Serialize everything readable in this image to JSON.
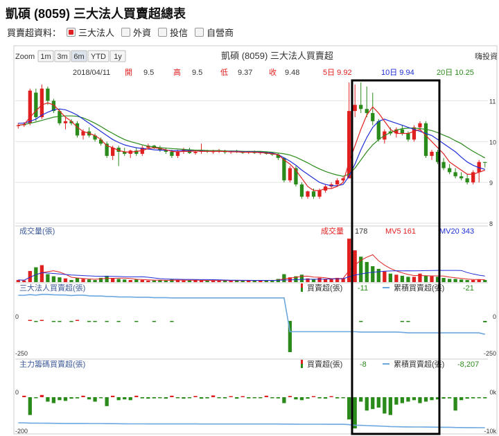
{
  "page_title": "凱碩 (8059) 三大法人買賣超總表",
  "filter": {
    "label": "買賣超資料：",
    "options": [
      {
        "label": "三大法人",
        "checked": true
      },
      {
        "label": "外資",
        "checked": false
      },
      {
        "label": "投信",
        "checked": false
      },
      {
        "label": "自營商",
        "checked": false
      }
    ]
  },
  "zoom": {
    "label": "Zoom",
    "buttons": [
      "1m",
      "3m",
      "6m",
      "YTD",
      "1y"
    ],
    "active": "6m"
  },
  "chart_title": "凱碩 (8059) 三大法人買賣超",
  "corner_label": "嗨投資",
  "info": {
    "date": "2018/04/11",
    "open_label": "開",
    "open": "9.5",
    "high_label": "高",
    "high": "9.5",
    "low_label": "低",
    "low": "9.37",
    "close_label": "收",
    "close": "9.48",
    "ma5": "5日 9.92",
    "ma10": "10日 9.94",
    "ma20": "20日 10.25"
  },
  "volume_panel": {
    "title": "成交量(張)",
    "vol_label": "成交量",
    "vol_value": "178",
    "mv5": "MV5 161",
    "mv20": "MV20 343"
  },
  "inst_panel": {
    "title": "三大法人買賣超(張)",
    "net_label": "買賣超(張)",
    "net_value": "-11",
    "cum_label": "累積買賣超(張)",
    "cum_value": "-21",
    "yticks": [
      "0",
      "-250"
    ],
    "right_ticks": [
      "0",
      "-250"
    ]
  },
  "main_panel": {
    "title": "主力籌碼買賣超(張)",
    "net_label": "買賣超(張)",
    "net_value": "-8",
    "cum_label": "累積買賣超(張)",
    "cum_value": "-8,207",
    "yticks": [
      "0",
      "-200"
    ],
    "right_ticks": [
      "0k",
      "-10k"
    ]
  },
  "price_ticks": [
    "11",
    "10",
    "9",
    "8"
  ],
  "colors": {
    "up": "#e02020",
    "down": "#2a8a1a",
    "ma5": "#e02020",
    "ma10": "#1e2fd6",
    "ma20": "#2a8a1a",
    "cumulative": "#6aa7df",
    "highlight": "#000000"
  },
  "chart_data": {
    "type": "candlestick",
    "y_range": [
      8,
      11.5
    ],
    "candles": [
      {
        "o": 10.38,
        "h": 10.45,
        "l": 10.32,
        "c": 10.4
      },
      {
        "o": 10.4,
        "h": 10.48,
        "l": 10.36,
        "c": 10.42
      },
      {
        "o": 10.45,
        "h": 11.3,
        "l": 10.4,
        "c": 11.25
      },
      {
        "o": 11.2,
        "h": 11.3,
        "l": 10.5,
        "c": 10.6
      },
      {
        "o": 10.6,
        "h": 11.4,
        "l": 10.55,
        "c": 11.3
      },
      {
        "o": 11.3,
        "h": 11.35,
        "l": 10.9,
        "c": 11.0
      },
      {
        "o": 11.0,
        "h": 11.05,
        "l": 10.7,
        "c": 10.75
      },
      {
        "o": 10.75,
        "h": 10.8,
        "l": 10.4,
        "c": 10.45
      },
      {
        "o": 10.45,
        "h": 10.6,
        "l": 10.3,
        "c": 10.5
      },
      {
        "o": 10.5,
        "h": 10.55,
        "l": 10.4,
        "c": 10.45
      },
      {
        "o": 10.45,
        "h": 10.5,
        "l": 10.1,
        "c": 10.15
      },
      {
        "o": 10.15,
        "h": 10.3,
        "l": 10.05,
        "c": 10.25
      },
      {
        "o": 10.25,
        "h": 10.35,
        "l": 10.1,
        "c": 10.15
      },
      {
        "o": 10.15,
        "h": 10.2,
        "l": 10.0,
        "c": 10.05
      },
      {
        "o": 10.05,
        "h": 10.1,
        "l": 9.9,
        "c": 9.95
      },
      {
        "o": 9.95,
        "h": 10.0,
        "l": 9.6,
        "c": 9.65
      },
      {
        "o": 9.65,
        "h": 9.9,
        "l": 9.55,
        "c": 9.85
      },
      {
        "o": 9.85,
        "h": 9.9,
        "l": 9.4,
        "c": 9.75
      },
      {
        "o": 9.75,
        "h": 9.85,
        "l": 9.65,
        "c": 9.7
      },
      {
        "o": 9.7,
        "h": 9.8,
        "l": 9.6,
        "c": 9.78
      },
      {
        "o": 9.78,
        "h": 9.85,
        "l": 9.65,
        "c": 9.7
      },
      {
        "o": 9.7,
        "h": 9.9,
        "l": 9.65,
        "c": 9.85
      },
      {
        "o": 9.85,
        "h": 9.95,
        "l": 9.8,
        "c": 9.9
      },
      {
        "o": 9.9,
        "h": 9.92,
        "l": 9.82,
        "c": 9.85
      },
      {
        "o": 9.85,
        "h": 9.9,
        "l": 9.75,
        "c": 9.8
      },
      {
        "o": 9.8,
        "h": 9.85,
        "l": 9.7,
        "c": 9.75
      },
      {
        "o": 9.75,
        "h": 9.8,
        "l": 9.6,
        "c": 9.65
      },
      {
        "o": 9.65,
        "h": 9.8,
        "l": 9.6,
        "c": 9.75
      },
      {
        "o": 9.75,
        "h": 9.85,
        "l": 9.7,
        "c": 9.8
      },
      {
        "o": 9.8,
        "h": 9.85,
        "l": 9.7,
        "c": 9.72
      },
      {
        "o": 9.72,
        "h": 9.78,
        "l": 9.68,
        "c": 9.75
      },
      {
        "o": 9.75,
        "h": 9.95,
        "l": 9.7,
        "c": 9.78
      },
      {
        "o": 9.78,
        "h": 9.8,
        "l": 9.72,
        "c": 9.75
      },
      {
        "o": 9.75,
        "h": 9.8,
        "l": 9.7,
        "c": 9.76
      },
      {
        "o": 9.76,
        "h": 9.82,
        "l": 9.72,
        "c": 9.78
      },
      {
        "o": 9.78,
        "h": 9.8,
        "l": 9.7,
        "c": 9.74
      },
      {
        "o": 9.74,
        "h": 9.78,
        "l": 9.7,
        "c": 9.76
      },
      {
        "o": 9.76,
        "h": 9.8,
        "l": 9.72,
        "c": 9.74
      },
      {
        "o": 9.74,
        "h": 9.77,
        "l": 9.7,
        "c": 9.73
      },
      {
        "o": 9.73,
        "h": 9.77,
        "l": 9.7,
        "c": 9.75
      },
      {
        "o": 9.75,
        "h": 9.78,
        "l": 9.7,
        "c": 9.72
      },
      {
        "o": 9.72,
        "h": 9.76,
        "l": 9.68,
        "c": 9.74
      },
      {
        "o": 9.74,
        "h": 9.76,
        "l": 9.68,
        "c": 9.7
      },
      {
        "o": 9.7,
        "h": 9.75,
        "l": 9.65,
        "c": 9.68
      },
      {
        "o": 9.68,
        "h": 9.72,
        "l": 9.55,
        "c": 9.6
      },
      {
        "o": 9.6,
        "h": 9.62,
        "l": 9.0,
        "c": 9.05
      },
      {
        "o": 9.05,
        "h": 9.4,
        "l": 9.0,
        "c": 9.35
      },
      {
        "o": 9.35,
        "h": 9.4,
        "l": 8.9,
        "c": 8.95
      },
      {
        "o": 8.95,
        "h": 9.0,
        "l": 8.6,
        "c": 8.65
      },
      {
        "o": 8.65,
        "h": 8.8,
        "l": 8.6,
        "c": 8.78
      },
      {
        "o": 8.78,
        "h": 8.85,
        "l": 8.6,
        "c": 8.65
      },
      {
        "o": 8.65,
        "h": 8.85,
        "l": 8.6,
        "c": 8.8
      },
      {
        "o": 8.8,
        "h": 8.95,
        "l": 8.75,
        "c": 8.9
      },
      {
        "o": 8.9,
        "h": 9.0,
        "l": 8.85,
        "c": 8.95
      },
      {
        "o": 8.95,
        "h": 9.1,
        "l": 8.9,
        "c": 9.05
      },
      {
        "o": 9.05,
        "h": 9.15,
        "l": 9.0,
        "c": 9.1
      },
      {
        "o": 9.1,
        "h": 11.45,
        "l": 9.1,
        "c": 10.75
      },
      {
        "o": 10.75,
        "h": 11.4,
        "l": 10.6,
        "c": 10.9
      },
      {
        "o": 10.9,
        "h": 11.45,
        "l": 10.7,
        "c": 10.8
      },
      {
        "o": 10.8,
        "h": 11.35,
        "l": 10.6,
        "c": 10.7
      },
      {
        "o": 10.7,
        "h": 11.2,
        "l": 10.4,
        "c": 10.5
      },
      {
        "o": 10.5,
        "h": 10.55,
        "l": 10.0,
        "c": 10.05
      },
      {
        "o": 10.05,
        "h": 10.3,
        "l": 9.95,
        "c": 10.25
      },
      {
        "o": 10.25,
        "h": 10.35,
        "l": 10.15,
        "c": 10.2
      },
      {
        "o": 10.2,
        "h": 10.35,
        "l": 10.1,
        "c": 10.3
      },
      {
        "o": 10.3,
        "h": 10.4,
        "l": 10.15,
        "c": 10.2
      },
      {
        "o": 10.2,
        "h": 10.25,
        "l": 10.0,
        "c": 10.05
      },
      {
        "o": 10.05,
        "h": 10.4,
        "l": 10.0,
        "c": 10.35
      },
      {
        "o": 10.35,
        "h": 10.5,
        "l": 10.25,
        "c": 10.45
      },
      {
        "o": 10.45,
        "h": 10.5,
        "l": 9.6,
        "c": 9.65
      },
      {
        "o": 9.65,
        "h": 9.8,
        "l": 9.55,
        "c": 9.75
      },
      {
        "o": 9.75,
        "h": 9.8,
        "l": 9.45,
        "c": 9.5
      },
      {
        "o": 9.5,
        "h": 9.6,
        "l": 9.3,
        "c": 9.35
      },
      {
        "o": 9.35,
        "h": 9.45,
        "l": 9.2,
        "c": 9.25
      },
      {
        "o": 9.25,
        "h": 9.35,
        "l": 9.1,
        "c": 9.15
      },
      {
        "o": 9.15,
        "h": 9.25,
        "l": 9.05,
        "c": 9.1
      },
      {
        "o": 9.1,
        "h": 9.2,
        "l": 8.95,
        "c": 9.0
      },
      {
        "o": 9.0,
        "h": 9.3,
        "l": 8.95,
        "c": 9.25
      },
      {
        "o": 9.25,
        "h": 9.55,
        "l": 9.0,
        "c": 9.5
      },
      {
        "o": 9.5,
        "h": 9.5,
        "l": 9.37,
        "c": 9.48
      }
    ],
    "ma5": [
      10.4,
      10.42,
      10.6,
      10.75,
      10.9,
      10.95,
      10.9,
      10.75,
      10.6,
      10.5,
      10.35,
      10.25,
      10.2,
      10.15,
      10.05,
      9.9,
      9.85,
      9.78,
      9.75,
      9.74,
      9.76,
      9.78,
      9.83,
      9.85,
      9.83,
      9.8,
      9.76,
      9.75,
      9.76,
      9.76,
      9.77,
      9.76,
      9.76,
      9.76,
      9.76,
      9.76,
      9.75,
      9.75,
      9.74,
      9.74,
      9.74,
      9.73,
      9.72,
      9.7,
      9.68,
      9.55,
      9.45,
      9.3,
      9.1,
      8.9,
      8.8,
      8.8,
      8.85,
      8.85,
      8.9,
      9.0,
      9.5,
      9.9,
      10.3,
      10.65,
      10.85,
      10.7,
      10.5,
      10.3,
      10.2,
      10.2,
      10.2,
      10.25,
      10.3,
      10.15,
      10.0,
      9.85,
      9.7,
      9.5,
      9.4,
      9.3,
      9.2,
      9.2,
      9.25,
      9.3
    ],
    "ma10": [
      10.45,
      10.45,
      10.5,
      10.55,
      10.65,
      10.72,
      10.78,
      10.8,
      10.78,
      10.72,
      10.65,
      10.55,
      10.45,
      10.35,
      10.25,
      10.15,
      10.05,
      9.98,
      9.92,
      9.88,
      9.85,
      9.83,
      9.82,
      9.8,
      9.79,
      9.79,
      9.78,
      9.78,
      9.78,
      9.78,
      9.77,
      9.77,
      9.76,
      9.76,
      9.76,
      9.76,
      9.76,
      9.76,
      9.75,
      9.75,
      9.75,
      9.74,
      9.73,
      9.72,
      9.68,
      9.6,
      9.52,
      9.42,
      9.3,
      9.2,
      9.1,
      9.0,
      8.95,
      8.92,
      8.92,
      8.95,
      9.15,
      9.45,
      9.8,
      10.1,
      10.35,
      10.5,
      10.55,
      10.5,
      10.45,
      10.4,
      10.35,
      10.3,
      10.25,
      10.2,
      10.15,
      10.05,
      9.95,
      9.85,
      9.75,
      9.62,
      9.5,
      9.42,
      9.36,
      9.32
    ],
    "ma20": [
      10.4,
      10.42,
      10.45,
      10.48,
      10.52,
      10.56,
      10.6,
      10.62,
      10.63,
      10.63,
      10.62,
      10.58,
      10.52,
      10.45,
      10.37,
      10.28,
      10.2,
      10.12,
      10.05,
      10.0,
      9.96,
      9.92,
      9.89,
      9.87,
      9.85,
      9.84,
      9.83,
      9.82,
      9.81,
      9.8,
      9.79,
      9.79,
      9.78,
      9.78,
      9.78,
      9.77,
      9.77,
      9.77,
      9.76,
      9.76,
      9.76,
      9.76,
      9.75,
      9.74,
      9.72,
      9.7,
      9.67,
      9.62,
      9.55,
      9.48,
      9.4,
      9.33,
      9.27,
      9.22,
      9.18,
      9.15,
      9.2,
      9.35,
      9.55,
      9.75,
      9.92,
      10.05,
      10.15,
      10.22,
      10.28,
      10.32,
      10.33,
      10.33,
      10.32,
      10.3,
      10.27,
      10.22,
      10.16,
      10.1,
      10.02,
      9.95,
      9.85,
      9.76,
      9.68,
      9.6
    ],
    "volume": [
      40,
      30,
      210,
      280,
      320,
      150,
      110,
      90,
      70,
      40,
      80,
      60,
      50,
      40,
      80,
      120,
      70,
      60,
      50,
      40,
      50,
      40,
      30,
      30,
      40,
      30,
      50,
      40,
      30,
      30,
      40,
      30,
      30,
      30,
      30,
      30,
      30,
      30,
      30,
      30,
      30,
      30,
      30,
      40,
      60,
      150,
      90,
      110,
      140,
      70,
      60,
      80,
      60,
      60,
      80,
      70,
      820,
      600,
      480,
      380,
      300,
      250,
      200,
      160,
      140,
      120,
      100,
      100,
      160,
      120,
      110,
      100,
      80,
      60,
      60,
      50,
      40,
      40,
      50,
      40
    ],
    "inst_net": [
      0,
      0,
      5,
      -4,
      6,
      0,
      -3,
      -2,
      0,
      -4,
      3,
      0,
      -5,
      -2,
      0,
      -3,
      0,
      -4,
      0,
      0,
      -2,
      0,
      0,
      -3,
      0,
      0,
      -2,
      0,
      0,
      0,
      0,
      0,
      0,
      0,
      0,
      0,
      0,
      0,
      0,
      0,
      0,
      0,
      0,
      0,
      0,
      0,
      -260,
      0,
      0,
      0,
      0,
      0,
      0,
      0,
      0,
      0,
      0,
      0,
      -3,
      0,
      0,
      0,
      0,
      0,
      0,
      -2,
      -4,
      0,
      0,
      0,
      0,
      0,
      0,
      0,
      0,
      0,
      0,
      0,
      0,
      -11
    ],
    "inst_cum": [
      0,
      0,
      5,
      1,
      7,
      7,
      4,
      2,
      2,
      -2,
      1,
      1,
      -4,
      -6,
      -6,
      -9,
      -9,
      -13,
      -13,
      -13,
      -15,
      -15,
      -15,
      -18,
      -18,
      -18,
      -20,
      -20,
      -20,
      -20,
      -20,
      -20,
      -20,
      -20,
      -20,
      -20,
      -20,
      -20,
      -20,
      -20,
      -20,
      -20,
      -20,
      -20,
      -20,
      -20,
      -280,
      -280,
      -280,
      -280,
      -280,
      -280,
      -280,
      -280,
      -280,
      -280,
      -280,
      -280,
      -283,
      -283,
      -283,
      -283,
      -283,
      -283,
      -283,
      -285,
      -289,
      -289,
      -289,
      -289,
      -289,
      -289,
      -289,
      -289,
      -289,
      -289,
      -289,
      -289,
      -289,
      -300
    ],
    "main_net": [
      0,
      10,
      -120,
      -5,
      15,
      -30,
      -40,
      -20,
      -25,
      -10,
      -8,
      10,
      -15,
      -30,
      -5,
      -60,
      10,
      -20,
      -15,
      -20,
      10,
      -8,
      -10,
      -8,
      -5,
      -10,
      10,
      -5,
      -10,
      -5,
      8,
      -10,
      -8,
      12,
      -5,
      -8,
      6,
      -10,
      5,
      -8,
      -6,
      -5,
      10,
      -5,
      -8,
      -40,
      8,
      -15,
      -20,
      -10,
      6,
      -8,
      -10,
      5,
      -8,
      -6,
      -150,
      -210,
      -30,
      -90,
      -80,
      -70,
      -110,
      -120,
      -50,
      -40,
      -30,
      -20,
      -40,
      -30,
      -20,
      -15,
      -10,
      -8,
      -90,
      -20,
      -10,
      -8,
      -5,
      -8
    ],
    "main_cum": [
      -9000,
      -9000,
      -9050,
      -9050,
      -9060,
      -9070,
      -9080,
      -9090,
      -9100,
      -9100,
      -9100,
      -9100,
      -9110,
      -9120,
      -9120,
      -9140,
      -9140,
      -9150,
      -9160,
      -9170,
      -9170,
      -9170,
      -9180,
      -9180,
      -9180,
      -9190,
      -9190,
      -9190,
      -9190,
      -9190,
      -9190,
      -9200,
      -9200,
      -9200,
      -9200,
      -9200,
      -9200,
      -9200,
      -9200,
      -9200,
      -9200,
      -9200,
      -9200,
      -9200,
      -9200,
      -9210,
      -9210,
      -9220,
      -9230,
      -9230,
      -9230,
      -9230,
      -9240,
      -9240,
      -9240,
      -9240,
      -9300,
      -9400,
      -9420,
      -9460,
      -9500,
      -9530,
      -9580,
      -9630,
      -9650,
      -9670,
      -9680,
      -9690,
      -9700,
      -9710,
      -9720,
      -9730,
      -9735,
      -9740,
      -9780,
      -9790,
      -9795,
      -9800,
      -9805,
      -9810
    ]
  }
}
